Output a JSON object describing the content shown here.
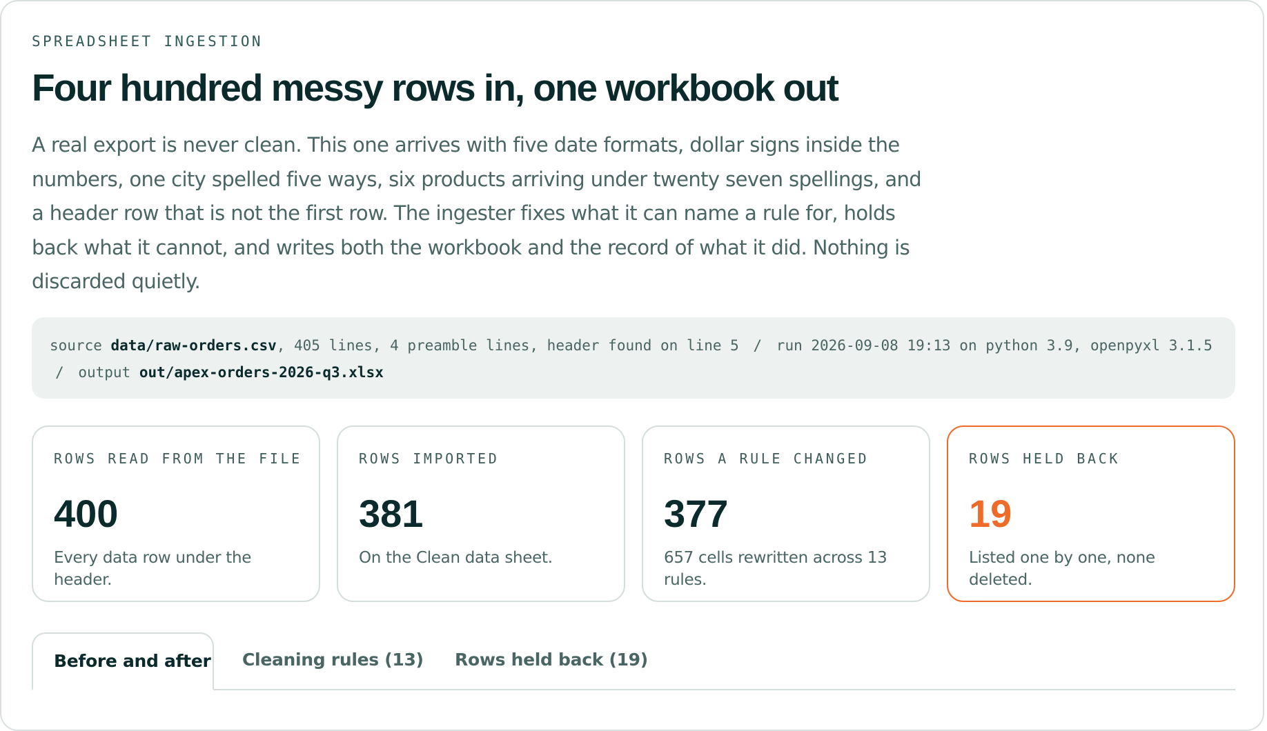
{
  "header": {
    "eyebrow": "SPREADSHEET INGESTION",
    "title": "Four hundred messy rows in, one workbook out",
    "lede": "A real export is never clean. This one arrives with five date formats, dollar signs inside the numbers, one city spelled five ways, six products arriving under twenty seven spellings, and a header row that is not the first row. The ingester fixes what it can name a rule for, holds back what it cannot, and writes both the workbook and the record of what it did. Nothing is discarded quietly."
  },
  "run_meta": {
    "source_label": "source",
    "source_path": "data/raw-orders.csv",
    "source_details": ", 405 lines, 4 preamble lines, header found on line 5",
    "separator": "/",
    "run_details": "run 2026-09-08 19:13 on python 3.9, openpyxl 3.1.5",
    "output_label": "output",
    "output_path": "out/apex-orders-2026-q3.xlsx"
  },
  "stats": [
    {
      "label": "ROWS READ FROM THE FILE",
      "value": "400",
      "description": "Every data row under the header."
    },
    {
      "label": "ROWS IMPORTED",
      "value": "381",
      "description": "On the Clean data sheet."
    },
    {
      "label": "ROWS A RULE CHANGED",
      "value": "377",
      "description": "657 cells rewritten across 13 rules."
    },
    {
      "label": "ROWS HELD BACK",
      "value": "19",
      "description": "Listed one by one, none deleted."
    }
  ],
  "tabs": [
    {
      "label": "Before and after",
      "active": true
    },
    {
      "label": "Cleaning rules (13)",
      "active": false
    },
    {
      "label": "Rows held back (19)",
      "active": false
    }
  ],
  "colors": {
    "accent": "#ef6b2a",
    "ink": "#0b2a2c",
    "muted": "#4a6664",
    "panel": "#edf2f1",
    "border": "#d6dedd"
  }
}
